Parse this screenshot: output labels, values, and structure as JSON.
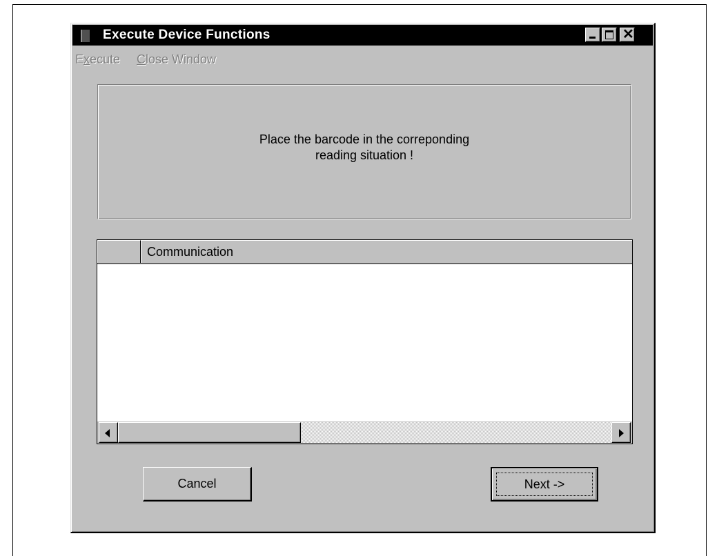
{
  "window": {
    "title": "Execute Device Functions"
  },
  "menubar": {
    "items": [
      {
        "label": "Execute",
        "mnemonic": "x",
        "enabled": false
      },
      {
        "label": "Close Window",
        "mnemonic": "C",
        "enabled": false
      }
    ]
  },
  "message": {
    "line1": "Place the barcode in the correponding",
    "line2": "reading situation !"
  },
  "list": {
    "columns": [
      "",
      "Communication"
    ],
    "rows": []
  },
  "scrollbar": {
    "position": 0.0,
    "visible_fraction": 0.37
  },
  "buttons": {
    "cancel_label": "Cancel",
    "next_label": "Next ->"
  }
}
